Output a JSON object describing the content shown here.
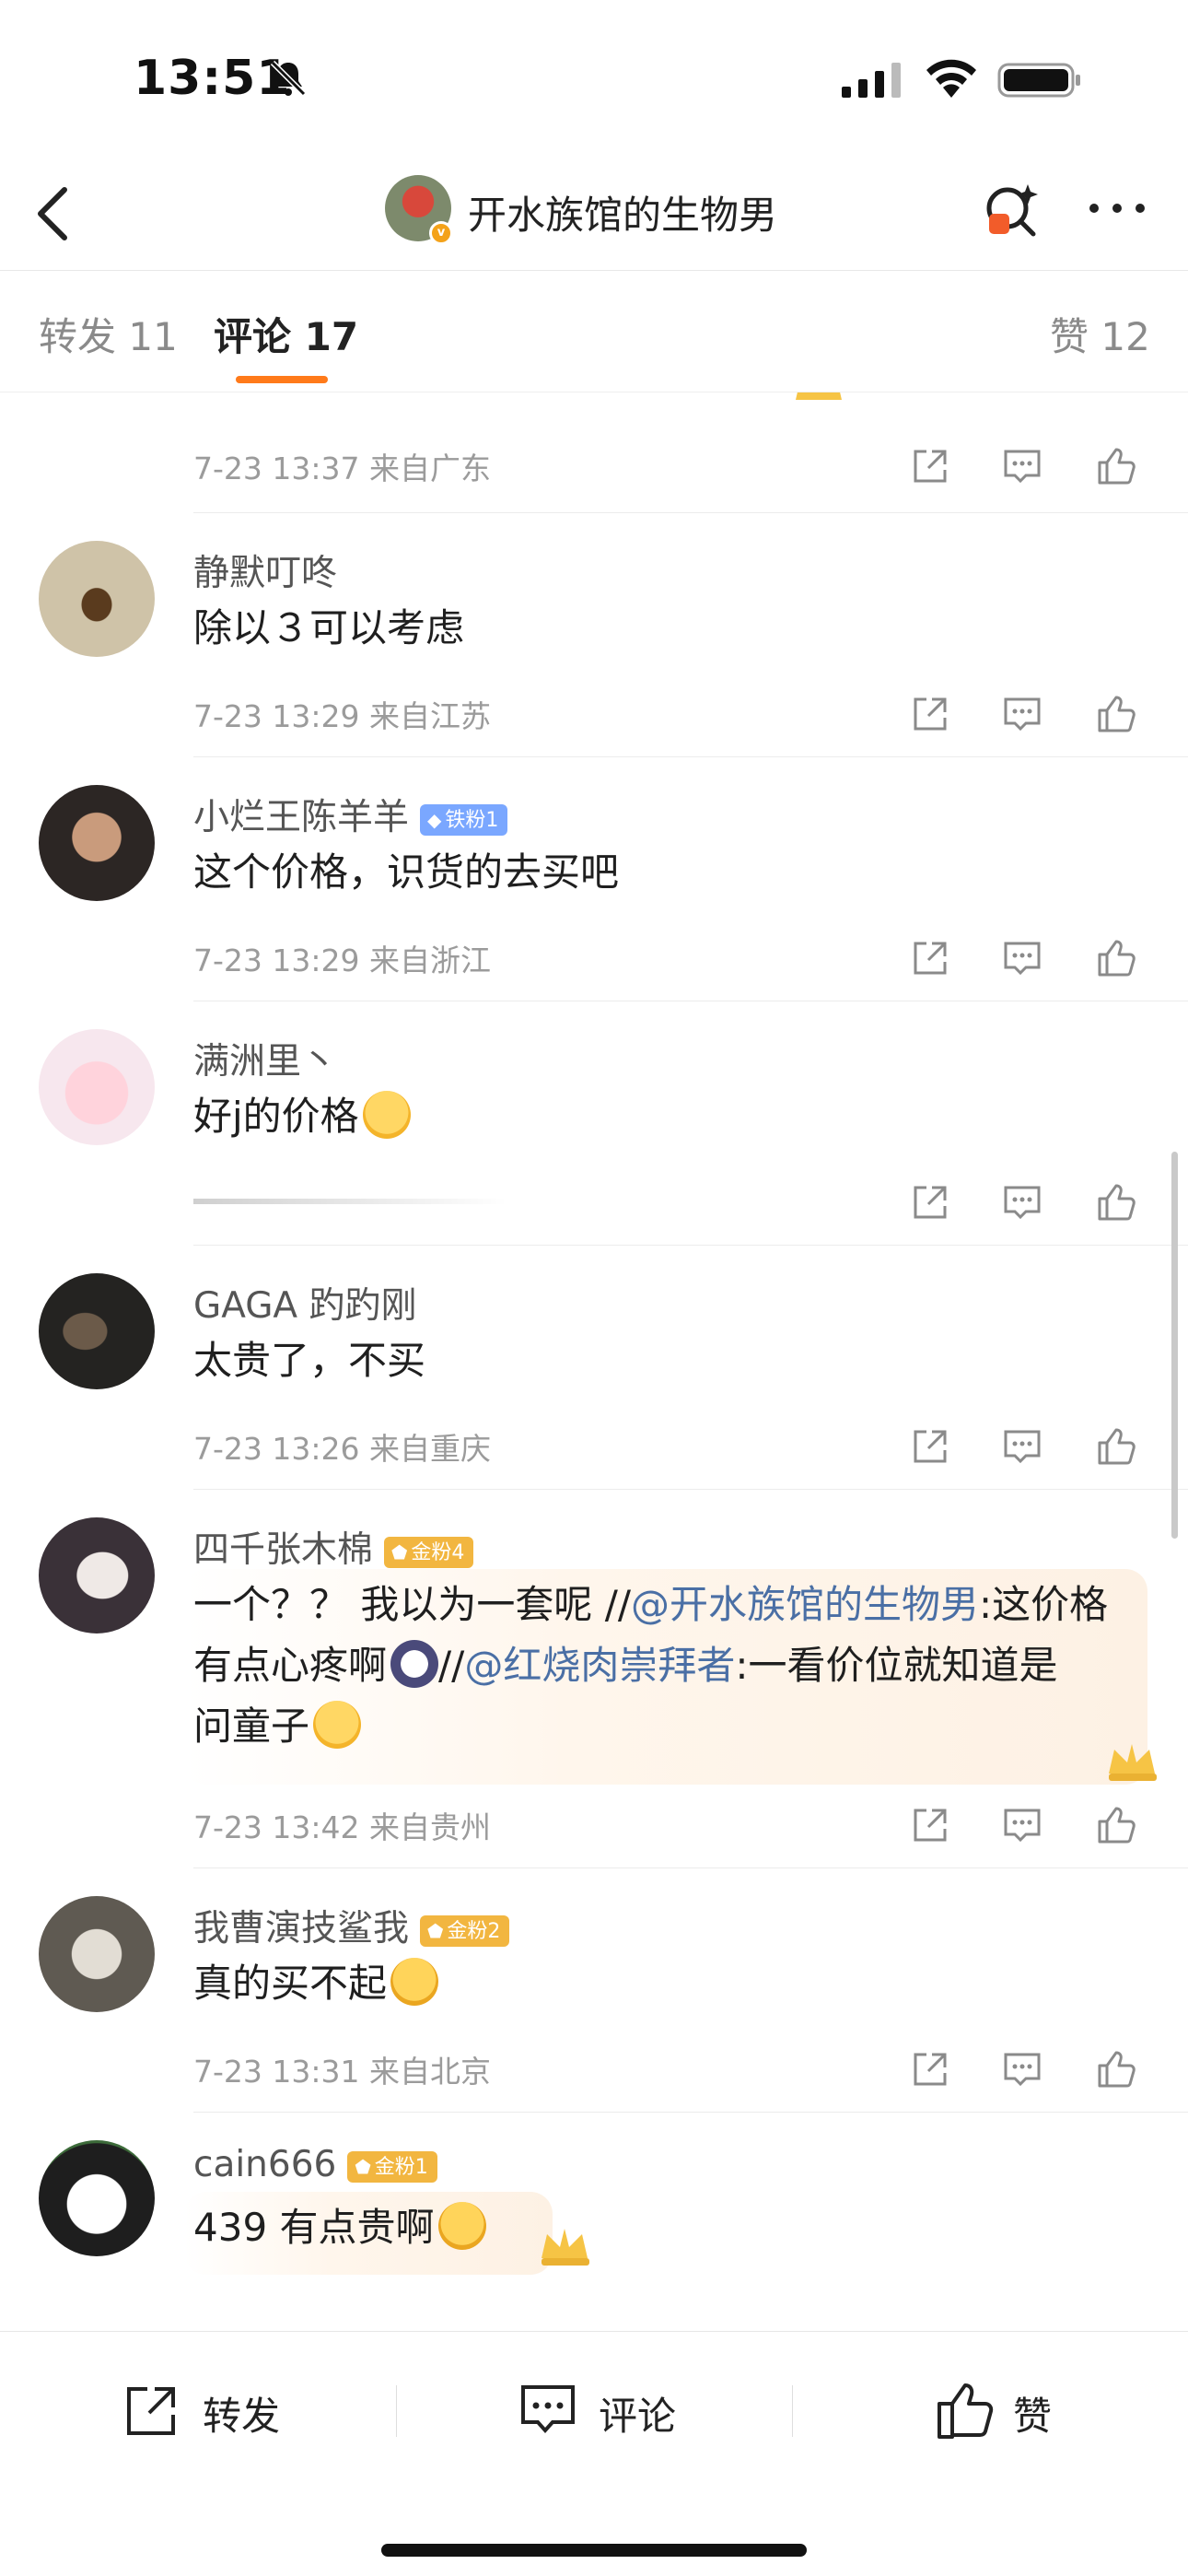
{
  "status_bar": {
    "time": "13:51"
  },
  "nav": {
    "title": "开水族馆的生物男"
  },
  "tabs": [
    {
      "label": "转发 11"
    },
    {
      "label": "评论 17"
    },
    {
      "label": "赞 12"
    }
  ],
  "comments": [
    {
      "meta": "7-23 13:37 来自广东"
    },
    {
      "username": "静默叮咚",
      "text": "除以３可以考虑",
      "meta": "7-23 13:29 来自江苏"
    },
    {
      "username": "小烂王陈羊羊",
      "badge": "铁粉1",
      "text": "这个价格，识货的去买吧",
      "meta": "7-23 13:29 来自浙江"
    },
    {
      "username": "满洲里丶",
      "text": "好j的价格",
      "meta": ""
    },
    {
      "username": "GAGA 趵趵刚",
      "text": "太贵了，不买",
      "meta": "7-23 13:26 来自重庆"
    },
    {
      "username": "四千张木棉",
      "badge": "金粉4",
      "line1_a": "一个？？ 我以为一套呢 //",
      "line1_mention": "@开水族馆的生物男",
      "line1_b": ":这价格",
      "line2_a": "有点心疼啊",
      "line2_sep": "//",
      "line2_mention": "@红烧肉崇拜者",
      "line2_b": ":一看价位就知道是",
      "line3": "问童子",
      "meta": "7-23 13:42 来自贵州"
    },
    {
      "username": "我曹演技鲨我",
      "badge": "金粉2",
      "text": "真的买不起",
      "meta": "7-23 13:31 来自北京"
    },
    {
      "username": "cain666",
      "badge": "金粉1",
      "text": "439 有点贵啊"
    }
  ],
  "bottom_bar": {
    "repost": "转发",
    "comment": "评论",
    "like": "赞"
  },
  "colors": {
    "accent": "#ff7a1a",
    "mention": "#4a6fa5",
    "iron_badge": "#7aa7ff",
    "gold_badge": "#f2b640"
  }
}
